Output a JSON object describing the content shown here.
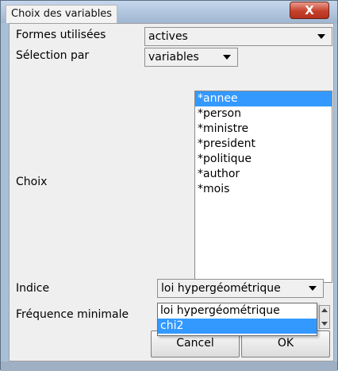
{
  "window": {
    "title": "Choix des variables",
    "close_label": "X"
  },
  "form": {
    "formes_label": "Formes utilisées",
    "formes_value": "actives",
    "selection_label": "Sélection par",
    "selection_value": "variables",
    "choix_label": "Choix",
    "choix_items": [
      "*annee",
      "*person",
      "*ministre",
      "*president",
      "*politique",
      "*author",
      "*mois"
    ],
    "choix_selected_index": 0,
    "indice_label": "Indice",
    "indice_value": "loi hypergéométrique",
    "indice_options": [
      "loi hypergéométrique",
      "chi2"
    ],
    "indice_highlighted_index": 1,
    "frequence_label": "Fréquence minimale"
  },
  "buttons": {
    "cancel_label": "Cancel",
    "ok_label": "OK"
  },
  "icons": {
    "dropdown_arrow": "chevron-down-icon",
    "close": "close-icon",
    "spinner": "spinner-arrows-icon"
  },
  "colors": {
    "selection": "#3399ff",
    "close_button": "#c6412c",
    "titlebar": "#a8bfd8"
  }
}
